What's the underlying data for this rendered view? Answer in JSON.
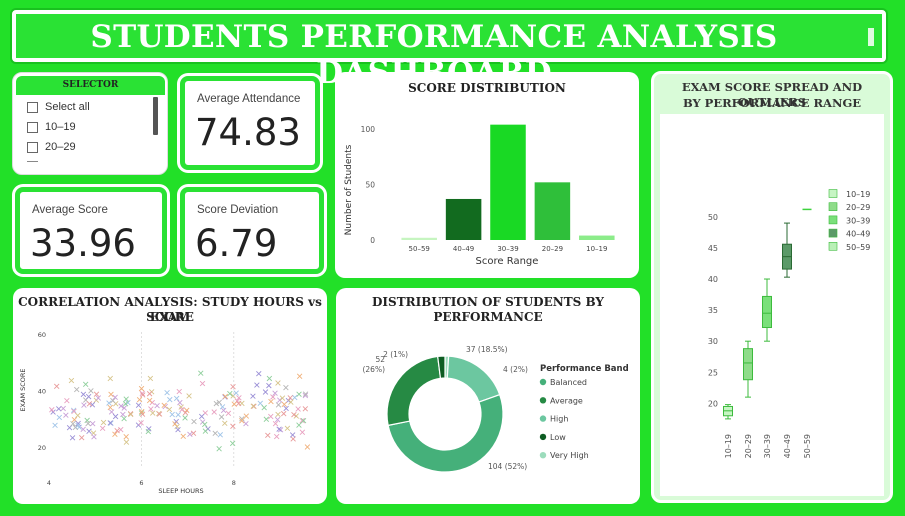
{
  "header": {
    "title": "STUDENTS PERFORMANCE ANALYSIS DASHBOARD"
  },
  "selector": {
    "title": "SELECTOR",
    "items": [
      "Select all",
      "10–19",
      "20–29"
    ]
  },
  "kpis": {
    "attendance": {
      "label": "Average Attendance",
      "value": "74.83"
    },
    "score": {
      "label": "Average Score",
      "value": "33.96"
    },
    "deviation": {
      "label": "Score Deviation",
      "value": "6.79"
    }
  },
  "score_distribution": {
    "title": "SCORE DISTRIBUTION",
    "ylabel": "Number of Students",
    "xlabel": "Score Range"
  },
  "correlation": {
    "title_line1": "CORRELATION ANALYSIS: STUDY HOURS vs EXAM",
    "title_line2": "SCORE",
    "ylabel": "EXAM SCORE",
    "xlabel": "SLEEP HOURS"
  },
  "donut": {
    "title_line1": "DISTRIBUTION OF STUDENTS BY",
    "title_line2": "PERFORMANCE",
    "legend_title": "Performance Band"
  },
  "boxplot": {
    "title_line1": "EXAM SCORE SPREAD AND OUTLIERS",
    "title_line2": "BY PERFORMANCE RANGE"
  },
  "colors": {
    "bg": "#22e028",
    "accent": "#2ae234",
    "dark_green": "#146b22",
    "mid_green": "#2d8a3e",
    "light_green": "#5cbf8c"
  },
  "chart_data": [
    {
      "type": "bar",
      "title": "SCORE DISTRIBUTION",
      "xlabel": "Score Range",
      "ylabel": "Number of Students",
      "categories": [
        "50–59",
        "40–49",
        "30–39",
        "20–29",
        "10–19"
      ],
      "values": [
        2,
        37,
        104,
        52,
        4
      ],
      "colors": [
        "#c6f5c0",
        "#126b1f",
        "#19d924",
        "#2fbf3a",
        "#8cec8a"
      ],
      "ylim": [
        0,
        110
      ],
      "yticks": [
        0,
        50,
        100
      ]
    },
    {
      "type": "scatter",
      "title": "CORRELATION ANALYSIS: STUDY HOURS vs EXAM SCORE",
      "xlabel": "SLEEP HOURS",
      "ylabel": "EXAM SCORE",
      "xticks": [
        4,
        6,
        8
      ],
      "yticks": [
        20,
        40,
        60
      ],
      "xlim": [
        4,
        9.8
      ],
      "ylim": [
        13,
        61
      ],
      "point_count": 200
    },
    {
      "type": "pie",
      "title": "DISTRIBUTION OF STUDENTS BY PERFORMANCE",
      "legend_title": "Performance Band",
      "slices": [
        {
          "label": "Balanced",
          "value": 104,
          "display": "104 (52%)",
          "color": "#45b07a"
        },
        {
          "label": "Average",
          "value": 52,
          "display": "52 (26%)",
          "color": "#268a44"
        },
        {
          "label": "High",
          "value": 37,
          "display": "37 (18.5%)",
          "color": "#6cc7a0"
        },
        {
          "label": "Low",
          "value": 4,
          "display": "4 (2%)",
          "color": "#0d5c22"
        },
        {
          "label": "Very High",
          "value": 2,
          "display": "2 (1%)",
          "color": "#9cdcbc"
        }
      ]
    },
    {
      "type": "box",
      "title": "EXAM SCORE SPREAD AND OUTLIERS BY PERFORMANCE RANGE",
      "yticks": [
        20,
        25,
        30,
        35,
        40,
        45,
        50
      ],
      "ylim": [
        17,
        54
      ],
      "categories": [
        "10–19",
        "20–29",
        "30–39",
        "40–49",
        "50–59"
      ],
      "legend": [
        "10–19",
        "20–29",
        "30–39",
        "40–49",
        "50–59"
      ],
      "boxes": [
        {
          "name": "10–19",
          "min": 17.5,
          "q1": 18,
          "median": 18.8,
          "q3": 19.5,
          "max": 19.8,
          "color": "#c7f5c4"
        },
        {
          "name": "20–29",
          "min": 21,
          "q1": 23.8,
          "median": 26.5,
          "q3": 28.8,
          "max": 30,
          "color": "#8fdc8a"
        },
        {
          "name": "30–39",
          "min": 30,
          "q1": 32.2,
          "median": 34.5,
          "q3": 37.2,
          "max": 40,
          "color": "#7ae07a"
        },
        {
          "name": "40–49",
          "min": 40.3,
          "q1": 41.6,
          "median": 43.6,
          "q3": 45.6,
          "max": 49,
          "color": "#5b9a68"
        },
        {
          "name": "50–59",
          "min": 51.2,
          "q1": 51.2,
          "median": 51.2,
          "q3": 51.2,
          "max": 51.2,
          "color": "#b9f0b6"
        }
      ]
    }
  ]
}
